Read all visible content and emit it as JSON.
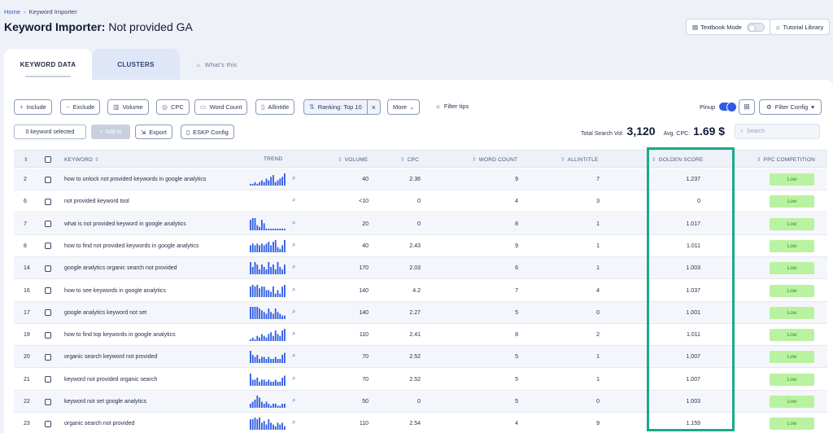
{
  "breadcrumb": {
    "home": "Home",
    "current": "Keyword Importer"
  },
  "page_title": {
    "bold": "Keyword Importer:",
    "rest": "Not provided GA"
  },
  "top_buttons": {
    "textbook": "Textbook Mode",
    "tutorial": "Tutorial Library"
  },
  "tabs": {
    "keyword_data": "KEYWORD DATA",
    "clusters": "CLUSTERS",
    "whats_this": "What's this"
  },
  "toolbar": {
    "include": "Include",
    "exclude": "Exclude",
    "volume": "Volume",
    "cpc": "CPC",
    "word_count": "Word Count",
    "allintitle": "Allintitle",
    "ranking": "Ranking: Top 10",
    "more": "More",
    "filter_tips": "Filter tips",
    "pinup": "Pinup",
    "filter_config": "Filter Config"
  },
  "actions": {
    "selected": "0 keyword selected",
    "add_to": "Add to",
    "export": "Export",
    "eskp": "ESKP Config"
  },
  "stats": {
    "total_label": "Total Search Vol:",
    "total_value": "3,120",
    "cpc_label": "Avg. CPC:",
    "cpc_value": "1.69 $"
  },
  "search": {
    "placeholder": "Search"
  },
  "columns": {
    "keyword": "KEYWORD",
    "trend": "TREND",
    "volume": "VOLUME",
    "cpc": "CPC",
    "word_count": "WORD COUNT",
    "allintitle": "ALLINTITLE",
    "golden": "GOLDEN SCORE",
    "ppc": "PPC COMPETITION"
  },
  "rows": [
    {
      "id": "2",
      "keyword": "how to unlock not provided keywords in google analytics",
      "trend": [
        1,
        1,
        2,
        1,
        2,
        3,
        2,
        4,
        3,
        5,
        6,
        2,
        3,
        4,
        5,
        7
      ],
      "volume": "40",
      "cpc": "2.36",
      "wc": "9",
      "ait": "7",
      "golden": "1.237",
      "ppc": "Low"
    },
    {
      "id": "6",
      "keyword": "not provided keyword tool",
      "trend": [],
      "volume": "<10",
      "cpc": "0",
      "wc": "4",
      "ait": "3",
      "golden": "0",
      "ppc": "Low"
    },
    {
      "id": "7",
      "keyword": "what is not provided keyword in google analytics",
      "trend": [
        6,
        7,
        7,
        3,
        2,
        6,
        4,
        1,
        1,
        1,
        1,
        1,
        1,
        1,
        1,
        1
      ],
      "volume": "20",
      "cpc": "0",
      "wc": "8",
      "ait": "1",
      "golden": "1.017",
      "ppc": "Low"
    },
    {
      "id": "8",
      "keyword": "how to find not provided keywords in google analytics",
      "trend": [
        4,
        5,
        4,
        5,
        4,
        5,
        4,
        5,
        6,
        4,
        6,
        7,
        3,
        2,
        4,
        7
      ],
      "volume": "40",
      "cpc": "2.43",
      "wc": "9",
      "ait": "1",
      "golden": "1.011",
      "ppc": "Low"
    },
    {
      "id": "14",
      "keyword": "google analytics organic search not provided",
      "trend": [
        5,
        3,
        5,
        4,
        2,
        4,
        3,
        2,
        5,
        3,
        4,
        2,
        5,
        3,
        2,
        4
      ],
      "volume": "170",
      "cpc": "2.03",
      "wc": "6",
      "ait": "1",
      "golden": "1.003",
      "ppc": "Low"
    },
    {
      "id": "16",
      "keyword": "how to see keywords in google analytics",
      "trend": [
        6,
        7,
        6,
        7,
        5,
        6,
        6,
        4,
        4,
        3,
        6,
        2,
        4,
        2,
        6,
        7
      ],
      "volume": "140",
      "cpc": "4.2",
      "wc": "7",
      "ait": "4",
      "golden": "1.037",
      "ppc": "Low"
    },
    {
      "id": "17",
      "keyword": "google analytics keyword not set",
      "trend": [
        7,
        7,
        7,
        7,
        6,
        5,
        4,
        3,
        6,
        4,
        3,
        6,
        4,
        3,
        2,
        2
      ],
      "volume": "140",
      "cpc": "2.27",
      "wc": "5",
      "ait": "0",
      "golden": "1.001",
      "ppc": "Low"
    },
    {
      "id": "19",
      "keyword": "how to find top keywords in google analytics",
      "trend": [
        1,
        2,
        1,
        3,
        2,
        4,
        3,
        2,
        4,
        5,
        3,
        6,
        4,
        3,
        6,
        7
      ],
      "volume": "110",
      "cpc": "2.41",
      "wc": "8",
      "ait": "2",
      "golden": "1.011",
      "ppc": "Low"
    },
    {
      "id": "20",
      "keyword": "organic search keyword not provided",
      "trend": [
        6,
        4,
        3,
        4,
        2,
        3,
        3,
        2,
        3,
        2,
        2,
        3,
        2,
        2,
        4,
        5
      ],
      "volume": "70",
      "cpc": "2.52",
      "wc": "5",
      "ait": "1",
      "golden": "1.007",
      "ppc": "Low"
    },
    {
      "id": "21",
      "keyword": "keyword not provided organic search",
      "trend": [
        6,
        3,
        3,
        4,
        2,
        3,
        3,
        2,
        3,
        2,
        2,
        3,
        2,
        2,
        4,
        5
      ],
      "volume": "70",
      "cpc": "2.52",
      "wc": "5",
      "ait": "1",
      "golden": "1.007",
      "ppc": "Low"
    },
    {
      "id": "22",
      "keyword": "keyword not set google analytics",
      "trend": [
        2,
        3,
        4,
        6,
        5,
        3,
        2,
        3,
        2,
        1,
        2,
        2,
        1,
        1,
        2,
        2
      ],
      "volume": "50",
      "cpc": "0",
      "wc": "5",
      "ait": "0",
      "golden": "1.003",
      "ppc": "Low"
    },
    {
      "id": "23",
      "keyword": "organic search not provided",
      "trend": [
        6,
        6,
        7,
        6,
        7,
        4,
        5,
        3,
        6,
        4,
        3,
        2,
        4,
        3,
        4,
        2
      ],
      "volume": "110",
      "cpc": "2.54",
      "wc": "4",
      "ait": "9",
      "golden": "1.159",
      "ppc": "Low"
    }
  ],
  "colors": {
    "accent": "#2d5be3",
    "highlight": "#1aaa8a",
    "low_badge": "#b9f2a1"
  }
}
